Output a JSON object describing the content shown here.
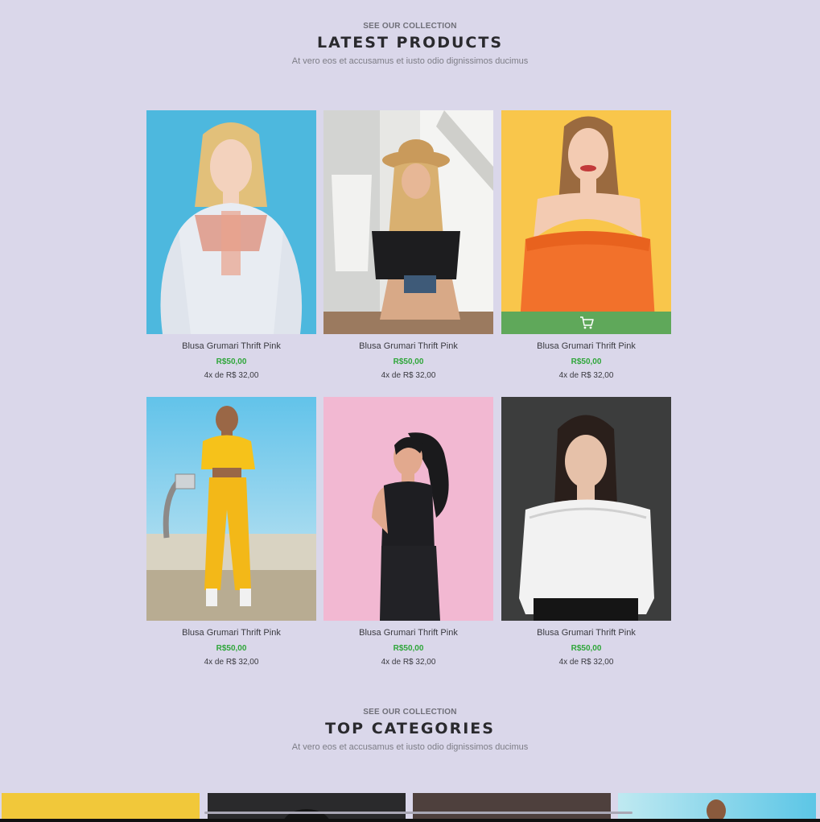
{
  "latest": {
    "eyebrow": "SEE OUR COLLECTION",
    "title": "LATEST PRODUCTS",
    "subtitle": "At vero eos et accusamus et iusto odio dignissimos ducimus"
  },
  "products": [
    {
      "name": "Blusa Grumari Thrift Pink",
      "price": "R$50,00",
      "installments": "4x de R$ 32,00"
    },
    {
      "name": "Blusa Grumari Thrift Pink",
      "price": "R$50,00",
      "installments": "4x de R$ 32,00"
    },
    {
      "name": "Blusa Grumari Thrift Pink",
      "price": "R$50,00",
      "installments": "4x de R$ 32,00"
    },
    {
      "name": "Blusa Grumari Thrift Pink",
      "price": "R$50,00",
      "installments": "4x de R$ 32,00"
    },
    {
      "name": "Blusa Grumari Thrift Pink",
      "price": "R$50,00",
      "installments": "4x de R$ 32,00"
    },
    {
      "name": "Blusa Grumari Thrift Pink",
      "price": "R$50,00",
      "installments": "4x de R$ 32,00"
    }
  ],
  "categories": {
    "eyebrow": "SEE OUR COLLECTION",
    "title": "TOP CATEGORIES",
    "subtitle": "At vero eos et accusamus et iusto odio dignissimos ducimus"
  },
  "colors": {
    "background": "#dad7ea",
    "price": "#2fa63a",
    "cart_bar": "#5fa85a"
  },
  "icons": {
    "cart": "shopping-cart-icon"
  }
}
